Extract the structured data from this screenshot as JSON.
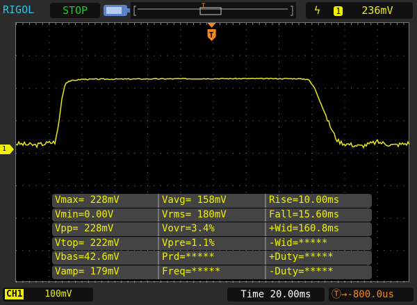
{
  "header": {
    "brand": "RIGOL",
    "run_state": "STOP",
    "trigger_level": "236mV",
    "trigger_channel": "1"
  },
  "channel": {
    "label": "CH1",
    "scale": "100mV",
    "marker": "1"
  },
  "timebase": {
    "label": "Time",
    "scale": "20.00ms",
    "trigger_offset": "-800.0us"
  },
  "colors": {
    "trace": "#e8e81a",
    "trigger": "#f08a1c",
    "brand": "#27c6e6",
    "run": "#19d219"
  },
  "measurements": [
    [
      "Vmax= 228mV",
      "Vavg= 158mV",
      "Rise=10.00ms"
    ],
    [
      "Vmin=0.00V",
      "Vrms= 180mV",
      "Fall=15.60ms"
    ],
    [
      "Vpp= 228mV",
      "Vovr=3.4%",
      "+Wid=160.8ms"
    ],
    [
      "Vtop= 222mV",
      "Vpre=1.1%",
      "-Wid=*****"
    ],
    [
      "Vbas=42.6mV",
      "Prd=*****",
      "+Duty=*****"
    ],
    [
      "Vamp= 179mV",
      "Freq=*****",
      "-Duty=*****"
    ]
  ],
  "waveform": {
    "time_ms": [
      -120,
      -108,
      -100,
      -96,
      -94,
      -92,
      -90,
      -88,
      -80,
      0,
      50,
      58,
      62,
      66,
      70,
      74,
      76,
      80,
      90,
      100,
      110,
      120
    ],
    "voltage_mv": [
      20,
      15,
      22,
      25,
      80,
      160,
      205,
      212,
      218,
      220,
      220,
      218,
      190,
      140,
      90,
      45,
      28,
      20,
      12,
      25,
      15,
      22
    ]
  }
}
